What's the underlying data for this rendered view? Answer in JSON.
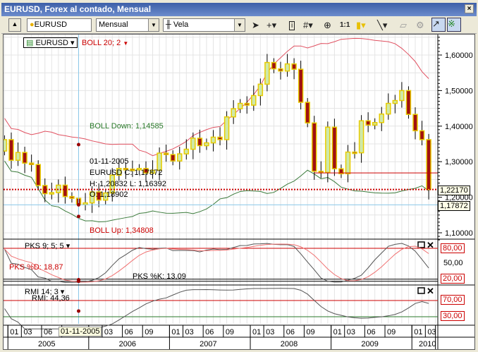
{
  "window": {
    "title": "EURUSD, Forex al contado, Mensual",
    "close": "×"
  },
  "toolbar": {
    "symbol": "EURUSD",
    "period": "Mensual",
    "chart_type": "Vela",
    "one_to_one": "1:1"
  },
  "legend": {
    "symbol": "EURUSD",
    "indicator": "BOLL 20; 2"
  },
  "labels": {
    "boll_down": "BOLL Down: 1,14585",
    "boll_up": "BOLL Up: 1,34808",
    "tip_date": "01-11-2005",
    "tip_line1": "EURUSD  C: 1,17872",
    "tip_line2": "H: 1,20832   L: 1,16392",
    "tip_line3": "O: 1,18902"
  },
  "price_axis": {
    "ticks": [
      "1,60000",
      "1,50000",
      "1,40000",
      "1,30000",
      "1,20000",
      "1,10000"
    ],
    "last": "1,22170",
    "cursor": "1,17872"
  },
  "pks": {
    "title": "PKS 9; 5; 5",
    "d_label": "PKS %D: 18,87",
    "k_label": "PKS %K: 13,09",
    "levels": [
      "80,00",
      "50,00",
      "20,00"
    ]
  },
  "rmi": {
    "title": "RMI 14; 3",
    "value_label": "RMI: 44,36",
    "levels": [
      "70,00",
      "30,00"
    ]
  },
  "xaxis": {
    "cursor": "01-11-2005",
    "years": [
      "2005",
      "2006",
      "2007",
      "2008",
      "2009",
      "2010"
    ],
    "months": [
      "01",
      "03",
      "06",
      "09"
    ]
  },
  "colors": {
    "up": "#cfe8a8",
    "down": "#a01010",
    "edge": "#e8cc00",
    "boll_up": "#e05060",
    "boll_down": "#3a7a3a"
  },
  "chart_data": {
    "type": "candlestick",
    "start": "2004-12",
    "closes": [
      1.362,
      1.304,
      1.326,
      1.296,
      1.292,
      1.233,
      1.21,
      1.213,
      1.234,
      1.202,
      1.197,
      1.179,
      1.184,
      1.215,
      1.192,
      1.212,
      1.262,
      1.281,
      1.279,
      1.277,
      1.281,
      1.268,
      1.276,
      1.324,
      1.32,
      1.302,
      1.322,
      1.335,
      1.366,
      1.345,
      1.353,
      1.369,
      1.362,
      1.426,
      1.449,
      1.464,
      1.459,
      1.486,
      1.518,
      1.579,
      1.561,
      1.555,
      1.575,
      1.56,
      1.467,
      1.409,
      1.273,
      1.27,
      1.397,
      1.28,
      1.266,
      1.327,
      1.325,
      1.415,
      1.403,
      1.41,
      1.434,
      1.464,
      1.472,
      1.5,
      1.433,
      1.387,
      1.362,
      1.2217
    ],
    "first_open": 1.33,
    "ylim": [
      1.08,
      1.66
    ]
  }
}
